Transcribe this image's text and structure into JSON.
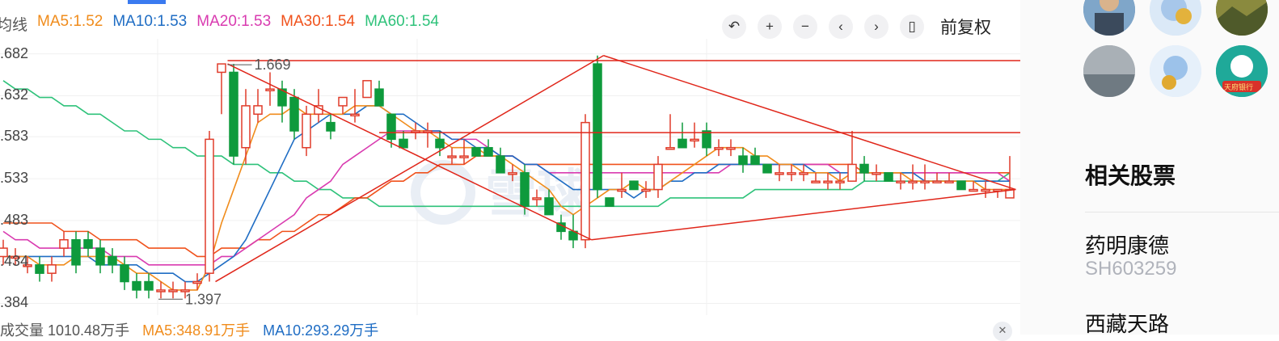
{
  "legend": {
    "title": "均线",
    "ma5": "MA5:1.52",
    "ma10": "MA10:1.53",
    "ma20": "MA20:1.53",
    "ma30": "MA30:1.54",
    "ma60": "MA60:1.54"
  },
  "colors": {
    "ma5": "#f08c1c",
    "ma10": "#1f6dc4",
    "ma20": "#d93bb0",
    "ma30": "#f0521c",
    "ma60": "#2ec27a",
    "up": "#e03c2a",
    "down": "#0e9a3c",
    "trendline": "#e0261a"
  },
  "toolbar": {
    "icons": [
      "undo-icon",
      "zoom-in-icon",
      "zoom-out-icon",
      "prev-icon",
      "next-icon",
      "candle-icon"
    ],
    "adjust_label": "前复权"
  },
  "yaxis": {
    "labels": [
      ".682",
      ".632",
      ".583",
      ".533",
      ".483",
      ".434",
      ".384"
    ]
  },
  "annotations": {
    "high": "1.669",
    "low": "1.397"
  },
  "watermark": "雪球",
  "volume_legend": {
    "total": "成交量 1010.48万手",
    "ma5": "MA5:348.91万手",
    "ma10": "MA10:293.29万手"
  },
  "related": {
    "title": "相关股票",
    "stocks": [
      {
        "name": "药明康德",
        "code": "SH603259"
      },
      {
        "name": "西藏天路",
        "code": ""
      }
    ]
  },
  "avatars": [
    "avatar-person",
    "avatar-mascot-gold",
    "avatar-landscape",
    "avatar-river",
    "avatar-mascot-blue",
    "avatar-badge"
  ],
  "avatar_badge_text": "天府银行",
  "chart_data": {
    "type": "candlestick",
    "ylim": [
      1.37,
      1.7
    ],
    "candles": [
      [
        1.44,
        1.45,
        1.46,
        1.43
      ],
      [
        1.44,
        1.44,
        1.45,
        1.43
      ],
      [
        1.43,
        1.43,
        1.44,
        1.42
      ],
      [
        1.43,
        1.42,
        1.44,
        1.41
      ],
      [
        1.42,
        1.43,
        1.44,
        1.41
      ],
      [
        1.45,
        1.46,
        1.47,
        1.44
      ],
      [
        1.46,
        1.43,
        1.47,
        1.42
      ],
      [
        1.46,
        1.45,
        1.47,
        1.44
      ],
      [
        1.45,
        1.43,
        1.46,
        1.42
      ],
      [
        1.44,
        1.43,
        1.45,
        1.42
      ],
      [
        1.43,
        1.41,
        1.44,
        1.4
      ],
      [
        1.41,
        1.4,
        1.42,
        1.39
      ],
      [
        1.41,
        1.4,
        1.42,
        1.39
      ],
      [
        1.4,
        1.4,
        1.41,
        1.39
      ],
      [
        1.4,
        1.4,
        1.41,
        1.39
      ],
      [
        1.4,
        1.4,
        1.41,
        1.39
      ],
      [
        1.41,
        1.41,
        1.42,
        1.4
      ],
      [
        1.42,
        1.58,
        1.59,
        1.41
      ],
      [
        1.66,
        1.67,
        1.67,
        1.61
      ],
      [
        1.66,
        1.56,
        1.67,
        1.55
      ],
      [
        1.57,
        1.62,
        1.64,
        1.55
      ],
      [
        1.61,
        1.62,
        1.64,
        1.6
      ],
      [
        1.64,
        1.64,
        1.66,
        1.62
      ],
      [
        1.64,
        1.62,
        1.65,
        1.6
      ],
      [
        1.63,
        1.59,
        1.64,
        1.58
      ],
      [
        1.57,
        1.61,
        1.62,
        1.56
      ],
      [
        1.61,
        1.62,
        1.64,
        1.6
      ],
      [
        1.6,
        1.59,
        1.61,
        1.58
      ],
      [
        1.62,
        1.63,
        1.63,
        1.61
      ],
      [
        1.61,
        1.61,
        1.64,
        1.6
      ],
      [
        1.63,
        1.65,
        1.65,
        1.63
      ],
      [
        1.64,
        1.62,
        1.65,
        1.62
      ],
      [
        1.61,
        1.58,
        1.61,
        1.57
      ],
      [
        1.58,
        1.57,
        1.59,
        1.57
      ],
      [
        1.59,
        1.59,
        1.6,
        1.58
      ],
      [
        1.59,
        1.59,
        1.6,
        1.57
      ],
      [
        1.58,
        1.57,
        1.59,
        1.56
      ],
      [
        1.56,
        1.56,
        1.57,
        1.55
      ],
      [
        1.56,
        1.56,
        1.58,
        1.55
      ],
      [
        1.57,
        1.56,
        1.57,
        1.56
      ],
      [
        1.57,
        1.56,
        1.58,
        1.56
      ],
      [
        1.56,
        1.54,
        1.57,
        1.54
      ],
      [
        1.54,
        1.54,
        1.55,
        1.53
      ],
      [
        1.54,
        1.5,
        1.55,
        1.49
      ],
      [
        1.51,
        1.51,
        1.52,
        1.5
      ],
      [
        1.51,
        1.49,
        1.52,
        1.49
      ],
      [
        1.48,
        1.47,
        1.49,
        1.46
      ],
      [
        1.47,
        1.46,
        1.49,
        1.45
      ],
      [
        1.46,
        1.6,
        1.61,
        1.45
      ],
      [
        1.67,
        1.52,
        1.68,
        1.51
      ],
      [
        1.51,
        1.5,
        1.51,
        1.5
      ],
      [
        1.52,
        1.52,
        1.54,
        1.51
      ],
      [
        1.53,
        1.52,
        1.53,
        1.52
      ],
      [
        1.52,
        1.52,
        1.53,
        1.51
      ],
      [
        1.52,
        1.55,
        1.56,
        1.51
      ],
      [
        1.57,
        1.57,
        1.61,
        1.57
      ],
      [
        1.58,
        1.57,
        1.6,
        1.57
      ],
      [
        1.58,
        1.58,
        1.6,
        1.57
      ],
      [
        1.59,
        1.57,
        1.6,
        1.56
      ],
      [
        1.57,
        1.57,
        1.58,
        1.56
      ],
      [
        1.57,
        1.57,
        1.58,
        1.56
      ],
      [
        1.56,
        1.55,
        1.57,
        1.54
      ],
      [
        1.56,
        1.55,
        1.57,
        1.55
      ],
      [
        1.55,
        1.54,
        1.55,
        1.54
      ],
      [
        1.54,
        1.54,
        1.55,
        1.53
      ],
      [
        1.54,
        1.54,
        1.55,
        1.53
      ],
      [
        1.54,
        1.54,
        1.55,
        1.53
      ],
      [
        1.53,
        1.53,
        1.54,
        1.53
      ],
      [
        1.53,
        1.53,
        1.54,
        1.52
      ],
      [
        1.53,
        1.53,
        1.54,
        1.52
      ],
      [
        1.53,
        1.55,
        1.59,
        1.53
      ],
      [
        1.55,
        1.54,
        1.56,
        1.53
      ],
      [
        1.54,
        1.54,
        1.55,
        1.53
      ],
      [
        1.54,
        1.53,
        1.54,
        1.53
      ],
      [
        1.53,
        1.53,
        1.54,
        1.52
      ],
      [
        1.53,
        1.53,
        1.55,
        1.52
      ],
      [
        1.53,
        1.53,
        1.55,
        1.52
      ],
      [
        1.53,
        1.53,
        1.54,
        1.53
      ],
      [
        1.53,
        1.53,
        1.54,
        1.53
      ],
      [
        1.53,
        1.52,
        1.53,
        1.52
      ],
      [
        1.52,
        1.52,
        1.53,
        1.52
      ],
      [
        1.52,
        1.52,
        1.53,
        1.51
      ],
      [
        1.52,
        1.52,
        1.52,
        1.51
      ],
      [
        1.51,
        1.52,
        1.56,
        1.51
      ]
    ],
    "ma5": [
      1.44,
      1.44,
      1.44,
      1.43,
      1.43,
      1.43,
      1.44,
      1.44,
      1.44,
      1.44,
      1.43,
      1.42,
      1.42,
      1.41,
      1.4,
      1.4,
      1.4,
      1.43,
      1.48,
      1.52,
      1.56,
      1.6,
      1.61,
      1.61,
      1.62,
      1.61,
      1.61,
      1.61,
      1.61,
      1.62,
      1.62,
      1.62,
      1.61,
      1.6,
      1.59,
      1.59,
      1.58,
      1.57,
      1.57,
      1.57,
      1.56,
      1.56,
      1.55,
      1.54,
      1.53,
      1.52,
      1.5,
      1.49,
      1.5,
      1.51,
      1.52,
      1.52,
      1.53,
      1.52,
      1.52,
      1.53,
      1.54,
      1.55,
      1.56,
      1.57,
      1.57,
      1.57,
      1.56,
      1.56,
      1.55,
      1.55,
      1.54,
      1.54,
      1.54,
      1.53,
      1.54,
      1.54,
      1.54,
      1.54,
      1.54,
      1.53,
      1.53,
      1.53,
      1.53,
      1.53,
      1.53,
      1.52,
      1.52,
      1.52
    ],
    "ma10": [
      1.44,
      1.44,
      1.44,
      1.44,
      1.44,
      1.44,
      1.44,
      1.44,
      1.43,
      1.43,
      1.43,
      1.43,
      1.42,
      1.42,
      1.42,
      1.41,
      1.41,
      1.42,
      1.43,
      1.44,
      1.46,
      1.49,
      1.52,
      1.55,
      1.58,
      1.59,
      1.6,
      1.61,
      1.61,
      1.61,
      1.62,
      1.62,
      1.61,
      1.61,
      1.6,
      1.59,
      1.59,
      1.58,
      1.58,
      1.57,
      1.57,
      1.56,
      1.56,
      1.55,
      1.55,
      1.54,
      1.53,
      1.52,
      1.52,
      1.52,
      1.52,
      1.52,
      1.51,
      1.52,
      1.52,
      1.53,
      1.53,
      1.54,
      1.54,
      1.55,
      1.55,
      1.55,
      1.55,
      1.55,
      1.55,
      1.55,
      1.55,
      1.54,
      1.54,
      1.54,
      1.54,
      1.54,
      1.54,
      1.54,
      1.54,
      1.54,
      1.53,
      1.53,
      1.53,
      1.53,
      1.53,
      1.53,
      1.53,
      1.53
    ],
    "ma20": [
      1.47,
      1.46,
      1.46,
      1.45,
      1.45,
      1.45,
      1.45,
      1.45,
      1.45,
      1.44,
      1.44,
      1.44,
      1.43,
      1.43,
      1.43,
      1.43,
      1.43,
      1.43,
      1.44,
      1.44,
      1.45,
      1.46,
      1.47,
      1.48,
      1.49,
      1.51,
      1.52,
      1.53,
      1.55,
      1.56,
      1.57,
      1.58,
      1.59,
      1.59,
      1.59,
      1.59,
      1.59,
      1.58,
      1.58,
      1.58,
      1.57,
      1.56,
      1.56,
      1.55,
      1.55,
      1.54,
      1.54,
      1.54,
      1.54,
      1.54,
      1.54,
      1.54,
      1.54,
      1.54,
      1.54,
      1.54,
      1.54,
      1.54,
      1.54,
      1.54,
      1.55,
      1.55,
      1.55,
      1.55,
      1.55,
      1.55,
      1.55,
      1.55,
      1.55,
      1.54,
      1.54,
      1.54,
      1.54,
      1.54,
      1.54,
      1.54,
      1.54,
      1.54,
      1.54,
      1.54,
      1.54,
      1.54,
      1.54,
      1.53
    ],
    "ma30": [
      1.48,
      1.48,
      1.48,
      1.48,
      1.48,
      1.47,
      1.47,
      1.47,
      1.46,
      1.46,
      1.46,
      1.46,
      1.45,
      1.45,
      1.45,
      1.45,
      1.44,
      1.44,
      1.45,
      1.45,
      1.45,
      1.46,
      1.46,
      1.47,
      1.47,
      1.48,
      1.49,
      1.49,
      1.5,
      1.51,
      1.51,
      1.52,
      1.53,
      1.53,
      1.54,
      1.54,
      1.55,
      1.55,
      1.55,
      1.56,
      1.56,
      1.56,
      1.56,
      1.55,
      1.55,
      1.55,
      1.55,
      1.55,
      1.55,
      1.55,
      1.55,
      1.55,
      1.55,
      1.55,
      1.55,
      1.55,
      1.55,
      1.55,
      1.55,
      1.55,
      1.55,
      1.55,
      1.55,
      1.55,
      1.55,
      1.55,
      1.55,
      1.55,
      1.55,
      1.55,
      1.55,
      1.54,
      1.54,
      1.54,
      1.54,
      1.54,
      1.54,
      1.54,
      1.54,
      1.54,
      1.54,
      1.54,
      1.54,
      1.54
    ],
    "ma60": [
      1.65,
      1.64,
      1.64,
      1.63,
      1.63,
      1.62,
      1.62,
      1.61,
      1.61,
      1.6,
      1.59,
      1.59,
      1.58,
      1.58,
      1.57,
      1.57,
      1.56,
      1.56,
      1.56,
      1.55,
      1.55,
      1.55,
      1.54,
      1.54,
      1.53,
      1.53,
      1.52,
      1.52,
      1.51,
      1.51,
      1.51,
      1.5,
      1.5,
      1.5,
      1.5,
      1.5,
      1.5,
      1.5,
      1.5,
      1.5,
      1.5,
      1.5,
      1.5,
      1.5,
      1.5,
      1.5,
      1.5,
      1.5,
      1.5,
      1.5,
      1.5,
      1.5,
      1.5,
      1.5,
      1.5,
      1.51,
      1.51,
      1.51,
      1.51,
      1.51,
      1.51,
      1.51,
      1.52,
      1.52,
      1.52,
      1.52,
      1.52,
      1.52,
      1.52,
      1.52,
      1.52,
      1.53,
      1.53,
      1.53,
      1.53,
      1.53,
      1.53,
      1.53,
      1.53,
      1.53,
      1.53,
      1.53,
      1.53,
      1.54
    ]
  }
}
